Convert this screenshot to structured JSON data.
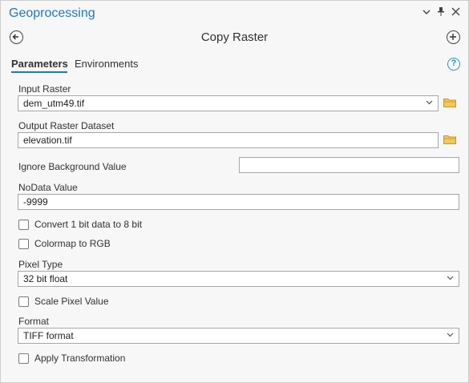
{
  "pane": {
    "title": "Geoprocessing",
    "controls": {
      "menu": "⌄",
      "pin": "📌",
      "close": "✕"
    }
  },
  "tool": {
    "name": "Copy Raster",
    "back_icon": "arrow-left-circle-icon",
    "add_icon": "plus-circle-icon"
  },
  "tabs": [
    {
      "label": "Parameters",
      "active": true
    },
    {
      "label": "Environments",
      "active": false
    }
  ],
  "help": {
    "label": "?"
  },
  "params": {
    "input_raster": {
      "label": "Input Raster",
      "value": "dem_utm49.tif"
    },
    "output_raster": {
      "label": "Output Raster Dataset",
      "value": "elevation.tif"
    },
    "ignore_bg": {
      "label": "Ignore Background Value",
      "value": ""
    },
    "nodata": {
      "label": "NoData Value",
      "value": "-9999"
    },
    "convert_1bit": {
      "label": "Convert 1 bit data to 8 bit",
      "checked": false
    },
    "colormap_rgb": {
      "label": "Colormap to RGB",
      "checked": false
    },
    "pixel_type": {
      "label": "Pixel Type",
      "value": "32 bit float"
    },
    "scale_pixel": {
      "label": "Scale Pixel Value",
      "checked": false
    },
    "format": {
      "label": "Format",
      "value": "TIFF format"
    },
    "apply_transform": {
      "label": "Apply Transformation",
      "checked": false
    }
  },
  "colors": {
    "accent": "#1d78c1",
    "folder": "#e8b84a"
  }
}
